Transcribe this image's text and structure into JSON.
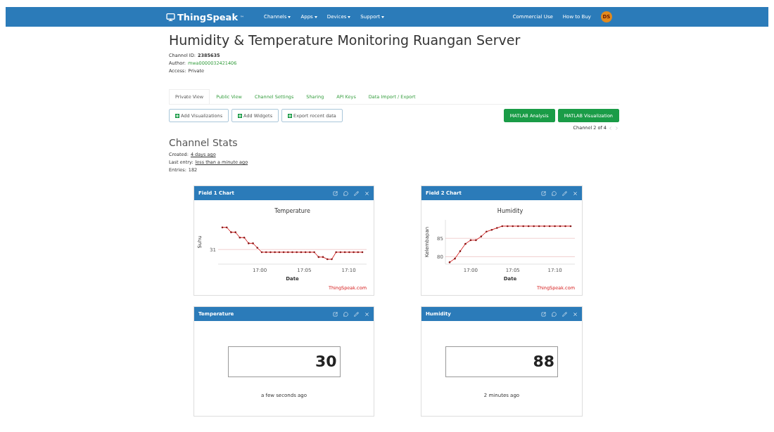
{
  "navbar": {
    "brand": "ThingSpeak",
    "trademark": "™",
    "menus": [
      "Channels",
      "Apps",
      "Devices",
      "Support"
    ],
    "links": [
      "Commercial Use",
      "How to Buy"
    ],
    "avatar": "DS"
  },
  "channel": {
    "title": "Humidity & Temperature Monitoring Ruangan Server",
    "meta": [
      {
        "label": "Channel ID:",
        "value": "2385635",
        "kind": "bold"
      },
      {
        "label": "Author:",
        "value": "mwa0000032421406",
        "kind": "link"
      },
      {
        "label": "Access:",
        "value": "Private",
        "kind": "plain"
      }
    ]
  },
  "tabs": [
    {
      "label": "Private View",
      "selected": true
    },
    {
      "label": "Public View",
      "selected": false
    },
    {
      "label": "Channel Settings",
      "selected": false
    },
    {
      "label": "Sharing",
      "selected": false
    },
    {
      "label": "API Keys",
      "selected": false
    },
    {
      "label": "Data Import / Export",
      "selected": false
    }
  ],
  "actions": [
    {
      "label": "Add Visualizations",
      "kind": "outline"
    },
    {
      "label": "Add Widgets",
      "kind": "outline"
    },
    {
      "label": "Export recent data",
      "kind": "outline"
    },
    {
      "label": "MATLAB Analysis",
      "kind": "primary"
    },
    {
      "label": "MATLAB Visualization",
      "kind": "primary"
    }
  ],
  "pager": "Channel 2 of 4",
  "stats": {
    "title": "Channel Stats",
    "rows": [
      {
        "label": "Created:",
        "value": "4 days ago",
        "kind": "link"
      },
      {
        "label": "Last entry:",
        "value": "less than a minute ago",
        "kind": "link"
      },
      {
        "label": "Entries:",
        "value": "182",
        "kind": "plain"
      }
    ]
  },
  "widgets": [
    {
      "kind": "plot",
      "title": "Field 1 Chart",
      "credit": "ThingSpeak.com",
      "plot": {
        "title": "Temperature",
        "xlabel": "Date",
        "ylabel": "Suhu",
        "y_tick_labels": [
          "31"
        ],
        "x_tick_labels": [
          "17:00",
          "17:05",
          "17:10"
        ]
      }
    },
    {
      "kind": "chart",
      "title": "Field 2 Chart",
      "credit": "ThingSpeak.com",
      "chart_data": {
        "type": "line",
        "title": "Humidity",
        "xlabel": "Date",
        "ylabel": "Kelembapan",
        "ylim": [
          78,
          90
        ],
        "yticks": [
          80,
          85
        ],
        "categories": [
          null,
          null,
          null,
          null,
          "17:00",
          null,
          null,
          null,
          null,
          null,
          null,
          null,
          "17:05",
          null,
          null,
          null,
          null,
          null,
          null,
          null,
          "17:10",
          null,
          null,
          null
        ],
        "series": [
          {
            "color": "#d62020",
            "values": [
              78.5,
              79.5,
              81.5,
              83.5,
              84.5,
              84.5,
              85.5,
              86.8,
              87.3,
              87.8,
              88.3,
              88.3,
              88.3,
              88.3,
              88.3,
              88.3,
              88.3,
              88.3,
              88.3,
              88.3,
              88.3,
              88.3,
              88.3,
              88.3
            ]
          }
        ]
      }
    },
    {
      "kind": "numeric",
      "title": "Temperature",
      "value": "30",
      "time": "a few seconds ago"
    },
    {
      "kind": "numeric",
      "title": "Humidity",
      "value": "88",
      "time": "2 minutes ago"
    }
  ]
}
